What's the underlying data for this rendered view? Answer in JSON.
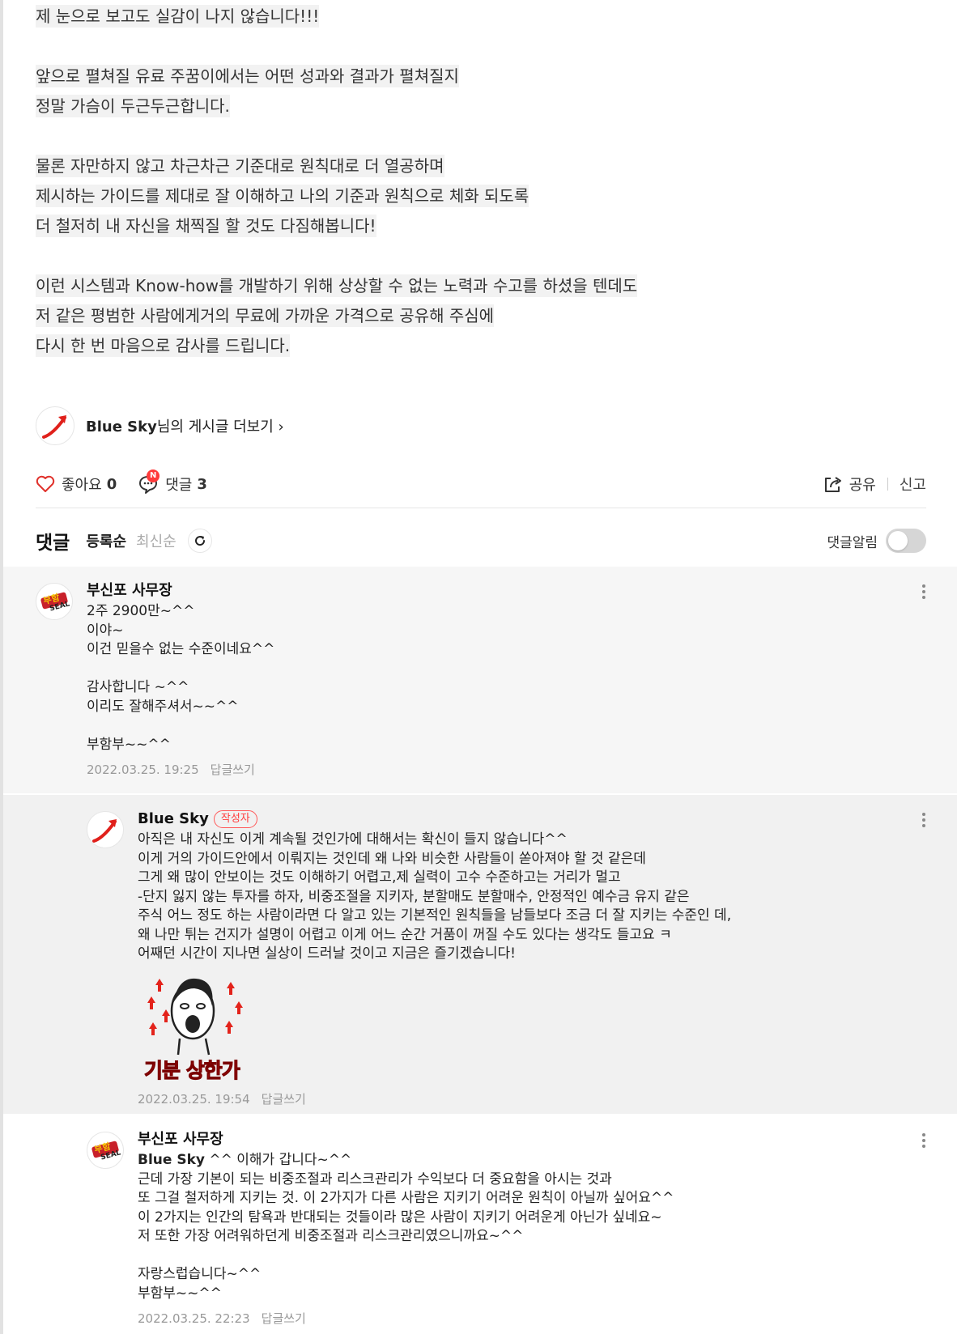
{
  "article": {
    "paragraphs": [
      [
        "제 눈으로 보고도 실감이 나지 않습니다!!!"
      ],
      [
        "앞으로 펼쳐질 유료 주꿈이에서는 어떤 성과와 결과가 펼쳐질지",
        "정말 가슴이 두근두근합니다."
      ],
      [
        "물론 자만하지 않고 차근차근 기준대로 원칙대로 더 열공하며",
        "제시하는 가이드를 제대로 잘 이해하고 나의 기준과 원칙으로 체화 되도록",
        "더 철저히 내 자신을 채찍질 할 것도 다짐해봅니다!"
      ],
      [
        "이런 시스템과 Know-how를 개발하기 위해 상상할 수 없는 노력과 수고를 하셨을 텐데도",
        "저 같은 평범한 사람에게거의 무료에 가까운 가격으로 공유해 주심에",
        "다시 한 번 마음으로 감사를 드립니다."
      ]
    ]
  },
  "author_more": {
    "name": "Blue Sky",
    "suffix": "님의 게시글 더보기 ›"
  },
  "actions": {
    "like_label": "좋아요",
    "like_count": "0",
    "comment_label": "댓글",
    "comment_count": "3",
    "new_badge": "N",
    "share_label": "공유",
    "report_label": "신고"
  },
  "comments_header": {
    "title": "댓글",
    "sort_registered": "등록순",
    "sort_latest": "최신순",
    "notify_label": "댓글알림",
    "notify_on": false
  },
  "comments": [
    {
      "nickname": "부신포 사무장",
      "lines": [
        "2주 2900만~^^",
        "이야~",
        "이건 믿을수 없는 수준이네요^^",
        "",
        "감사합니다 ~^^",
        "이리도 잘해주셔서~~^^",
        "",
        "부함부~~^^"
      ],
      "date": "2022.03.25. 19:25",
      "reply_label": "답글쓰기"
    },
    {
      "nickname": "Blue Sky",
      "writer_badge": "작성자",
      "lines": [
        "아직은 내 자신도 이게 계속될 것인가에 대해서는 확신이 들지 않습니다^^",
        "이게 거의 가이드안에서 이뤄지는 것인데 왜 나와 비슷한 사람들이 쏟아져야 할 것 같은데",
        "그게 왜 많이 안보이는 것도 이해하기 어렵고,제 실력이 고수 수준하고는 거리가 멀고",
        "-단지 잃지 않는 투자를 하자, 비중조절을 지키자, 분할매도 분할매수, 안정적인 예수금 유지 같은",
        "주식 어느 정도 하는 사람이라면 다 알고 있는 기본적인 원칙들을 남들보다 조금 더 잘 지키는 수준인 데,",
        "왜 나만 튀는 건지가 설명이 어렵고 이게 어느 순간 거품이 꺼질 수도 있다는 생각도 들고요 ㅋ",
        "어째던 시간이 지나면 실상이 드러날 것이고 지금은 즐기겠습니다!"
      ],
      "sticker_caption": "기분 상한가",
      "date": "2022.03.25. 19:54",
      "reply_label": "답글쓰기"
    },
    {
      "nickname": "부신포 사무장",
      "mention": "Blue Sky",
      "first_line_rest": " ^^ 이해가 갑니다~^^",
      "lines": [
        "근데 가장 기본이 되는 비중조절과 리스크관리가 수익보다 더 중요함을 아시는 것과",
        "또 그걸 철저하게 지키는 것. 이 2가지가 다른 사람은 지키기 어려운 원칙이 아닐까 싶어요^^",
        "이 2가지는 인간의 탐욕과 반대되는 것들이라 많은 사람이 지키기 어려운게 아닌가 싶네요~",
        "저 또한 가장 어려워하던게 비중조절과 리스크관리였으니까요~^^",
        "",
        "자랑스럽습니다~^^",
        "부함부~~^^"
      ],
      "date": "2022.03.25. 22:23",
      "reply_label": "답글쓰기"
    }
  ]
}
